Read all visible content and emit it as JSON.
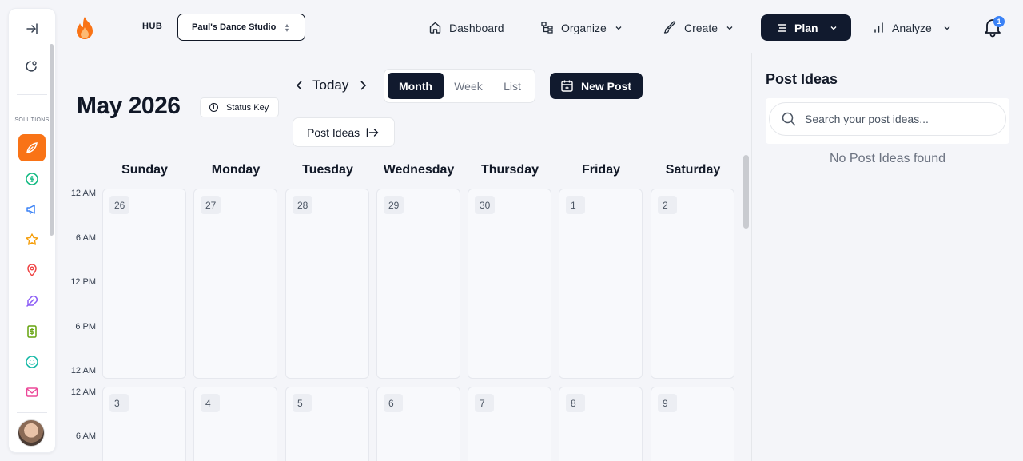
{
  "sidebar": {
    "solutions_label": "SOLUTIONS",
    "icons": [
      "collapse-sidebar-icon",
      "theme-toggle-icon",
      "leaf-icon",
      "dollar-circle-icon",
      "megaphone-icon",
      "star-icon",
      "map-pin-icon",
      "feather-icon",
      "dollar-note-icon",
      "smile-icon",
      "mail-icon"
    ],
    "accent": "#f97316"
  },
  "header": {
    "hub_label": "HUB",
    "studio_name": "Paul's Dance Studio",
    "nav": {
      "dashboard": "Dashboard",
      "organize": "Organize",
      "create": "Create",
      "plan": "Plan",
      "analyze": "Analyze"
    },
    "notification_count": "1"
  },
  "calendar": {
    "title": "May 2026",
    "status_key": "Status Key",
    "today": "Today",
    "views": {
      "month": "Month",
      "week": "Week",
      "list": "List"
    },
    "active_view": "Month",
    "new_post": "New Post",
    "post_ideas_button": "Post Ideas",
    "days": [
      "Sunday",
      "Monday",
      "Tuesday",
      "Wednesday",
      "Thursday",
      "Friday",
      "Saturday"
    ],
    "time_labels_week1": [
      "12 AM",
      "6 AM",
      "12 PM",
      "6 PM",
      "12 AM"
    ],
    "time_labels_week2": [
      "12 AM",
      "6 AM"
    ],
    "week1": [
      "26",
      "27",
      "28",
      "29",
      "30",
      "1",
      "2"
    ],
    "week2": [
      "3",
      "4",
      "5",
      "6",
      "7",
      "8",
      "9"
    ]
  },
  "post_ideas": {
    "title": "Post Ideas",
    "search_placeholder": "Search your post ideas...",
    "search_value": "",
    "empty_text": "No Post Ideas found"
  }
}
